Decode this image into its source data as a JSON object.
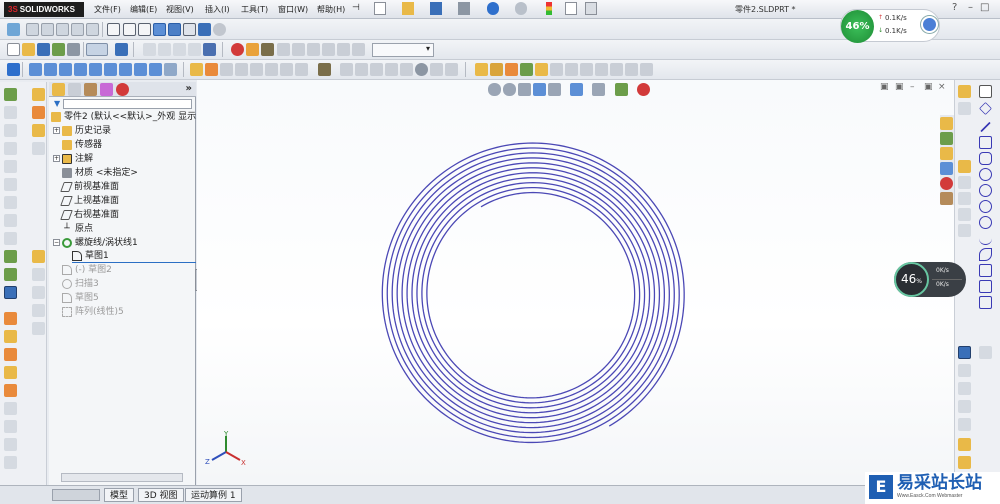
{
  "app": {
    "logo": "SOLIDWORKS",
    "logo_prefix": "3S",
    "document_title": "零件2.SLDPRT *"
  },
  "menu": {
    "items": [
      "文件(F)",
      "编辑(E)",
      "视图(V)",
      "插入(I)",
      "工具(T)",
      "窗口(W)",
      "帮助(H)"
    ]
  },
  "feature_tree": {
    "root": "零件2  (默认<<默认>_外观 显示",
    "items": [
      {
        "label": "历史记录",
        "icon": "history-icon",
        "dim": false
      },
      {
        "label": "传感器",
        "icon": "sensor-icon",
        "dim": false
      },
      {
        "label": "注解",
        "icon": "annotation-icon",
        "dim": false
      },
      {
        "label": "材质 <未指定>",
        "icon": "material-icon",
        "dim": false
      },
      {
        "label": "前视基准面",
        "icon": "plane-icon",
        "dim": false
      },
      {
        "label": "上视基准面",
        "icon": "plane-icon",
        "dim": false
      },
      {
        "label": "右视基准面",
        "icon": "plane-icon",
        "dim": false
      },
      {
        "label": "原点",
        "icon": "origin-icon",
        "dim": false
      },
      {
        "label": "螺旋线/涡状线1",
        "icon": "helix-icon",
        "dim": false
      },
      {
        "label": "草图1",
        "icon": "sketch-icon",
        "dim": false
      },
      {
        "label": "(-) 草图2",
        "icon": "sketch-icon",
        "dim": true
      },
      {
        "label": "扫描3",
        "icon": "sweep-icon",
        "dim": true
      },
      {
        "label": "草图5",
        "icon": "sketch-icon",
        "dim": true
      },
      {
        "label": "阵列(线性)5",
        "icon": "pattern-icon",
        "dim": true
      }
    ]
  },
  "bottom_tabs": [
    "模型",
    "3D 视图",
    "运动算例 1"
  ],
  "net_meter": {
    "percent": "46%",
    "up": "0.1K/s",
    "down": "0.1K/s"
  },
  "net_meter_dark": {
    "percent": "46",
    "unit": "%",
    "up": "0K/s",
    "down": "0K/s"
  },
  "triad": {
    "x": "X",
    "y": "Y",
    "z": "Z"
  },
  "watermark": {
    "logo": "E",
    "text": "易采站长站",
    "url": "Www.Easck.Com Webmaster"
  },
  "colors": {
    "spiral": "#4b48b5",
    "accent": "#2b6fc4"
  }
}
